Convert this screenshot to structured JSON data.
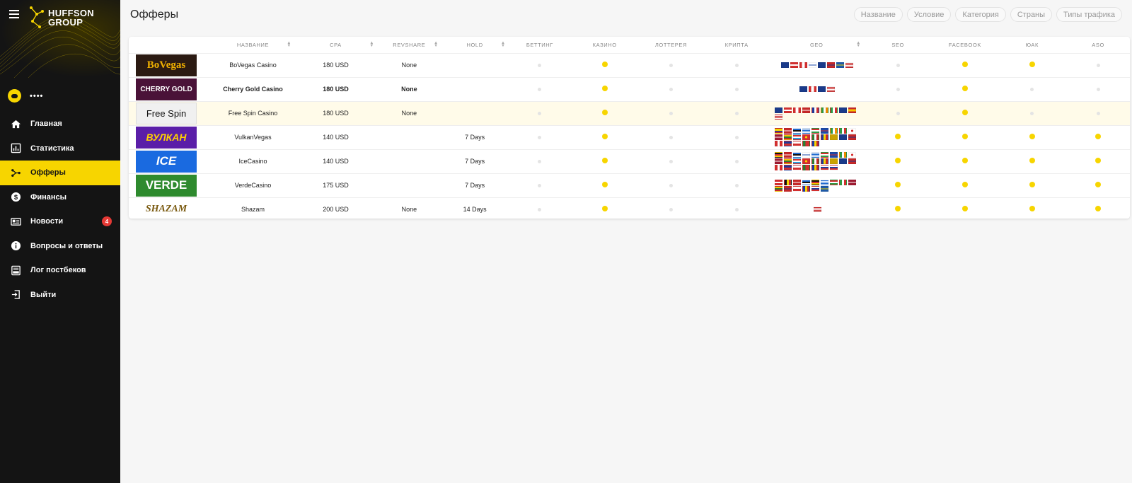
{
  "app": {
    "brand_line1": "HUFFSON",
    "brand_line2": "GROUP",
    "user_name": "••••"
  },
  "sidebar": {
    "items": [
      {
        "label": "Главная",
        "icon": "home-icon"
      },
      {
        "label": "Статистика",
        "icon": "chart-icon"
      },
      {
        "label": "Офферы",
        "icon": "offers-icon",
        "active": true
      },
      {
        "label": "Финансы",
        "icon": "dollar-icon"
      },
      {
        "label": "Новости",
        "icon": "news-icon",
        "badge": "4"
      },
      {
        "label": "Вопросы и ответы",
        "icon": "info-icon"
      },
      {
        "label": "Лог постбеков",
        "icon": "log-icon"
      },
      {
        "label": "Выйти",
        "icon": "logout-icon"
      }
    ]
  },
  "page": {
    "title": "Офферы"
  },
  "filters": [
    "Название",
    "Условие",
    "Категория",
    "Страны",
    "Типы трафика"
  ],
  "table": {
    "headers": [
      "",
      "НАЗВАНИЕ",
      "CPA",
      "REVSHARE",
      "HOLD",
      "БЕТТИНГ",
      "КАЗИНО",
      "ЛОТТЕРЕЯ",
      "КРИПТА",
      "GEO",
      "SEO",
      "FACEBOOK",
      "ЮАК",
      "ASO"
    ],
    "rows": [
      {
        "brand": "BoVegas",
        "name": "BoVegas Casino",
        "cpa": "180 USD",
        "revshare": "None",
        "hold": "",
        "betting": false,
        "casino": true,
        "lottery": false,
        "crypto": false,
        "geo": [
          "au",
          "at",
          "ca",
          "fi",
          "nz",
          "no",
          "se",
          "us"
        ],
        "seo": false,
        "facebook": true,
        "uac": true,
        "aso": false
      },
      {
        "brand": "CHERRY GOLD",
        "name": "Cherry Gold Casino",
        "cpa": "180 USD",
        "revshare": "None",
        "hold": "",
        "betting": false,
        "casino": true,
        "lottery": false,
        "crypto": false,
        "geo": [
          "au",
          "ca",
          "nz",
          "us"
        ],
        "seo": false,
        "facebook": true,
        "uac": false,
        "aso": false,
        "bold": true
      },
      {
        "brand": "Free Spin",
        "name": "Free Spin Casino",
        "cpa": "180 USD",
        "revshare": "None",
        "hold": "",
        "betting": false,
        "casino": true,
        "lottery": false,
        "crypto": false,
        "geo": [
          "au",
          "at",
          "ca",
          "dk",
          "fr",
          "ie",
          "it",
          "nz",
          "es",
          "us"
        ],
        "seo": false,
        "facebook": true,
        "uac": false,
        "aso": false,
        "highlight": true
      },
      {
        "brand": "ВУЛКАН",
        "name": "VulkanVegas",
        "cpa": "140 USD",
        "revshare": "",
        "hold": "7 Days",
        "betting": false,
        "casino": true,
        "lottery": false,
        "crypto": false,
        "geo": [
          "co",
          "dk",
          "ee",
          "gr",
          "hu",
          "is",
          "ie",
          "it",
          "jp",
          "lv",
          "lt",
          "lu",
          "mk",
          "mx",
          "md",
          "me",
          "nz",
          "no",
          "pe",
          "ph",
          "pl",
          "pt",
          "ro"
        ],
        "seo": true,
        "facebook": true,
        "uac": true,
        "aso": true
      },
      {
        "brand": "ICE",
        "name": "IceCasino",
        "cpa": "140 USD",
        "revshare": "",
        "hold": "7 Days",
        "betting": false,
        "casino": true,
        "lottery": false,
        "crypto": false,
        "geo": [
          "de",
          "dk",
          "ee",
          "fi",
          "gr",
          "hu",
          "is",
          "ie",
          "jp",
          "lv",
          "lt",
          "lu",
          "mk",
          "mx",
          "md",
          "me",
          "nz",
          "no",
          "pe",
          "ph",
          "pl",
          "pt",
          "ro",
          "sk",
          "si"
        ],
        "seo": true,
        "facebook": true,
        "uac": true,
        "aso": true
      },
      {
        "brand": "VERDE",
        "name": "VerdeCasino",
        "cpa": "175 USD",
        "revshare": "",
        "hold": "7 Days",
        "betting": false,
        "casino": true,
        "lottery": false,
        "crypto": false,
        "geo": [
          "at",
          "be",
          "dk",
          "ee",
          "de",
          "gr",
          "hu",
          "it",
          "lv",
          "lt",
          "no",
          "pl",
          "ro",
          "sk",
          "se"
        ],
        "seo": true,
        "facebook": true,
        "uac": true,
        "aso": true
      },
      {
        "brand": "SHAZAM",
        "name": "Shazam",
        "cpa": "200 USD",
        "revshare": "None",
        "hold": "14 Days",
        "betting": false,
        "casino": true,
        "lottery": false,
        "crypto": false,
        "geo": [
          "us"
        ],
        "seo": true,
        "facebook": true,
        "uac": true,
        "aso": true
      }
    ]
  },
  "colors": {
    "accent": "#f7d500",
    "sidebar_bg": "#141414",
    "badge": "#e53935"
  }
}
